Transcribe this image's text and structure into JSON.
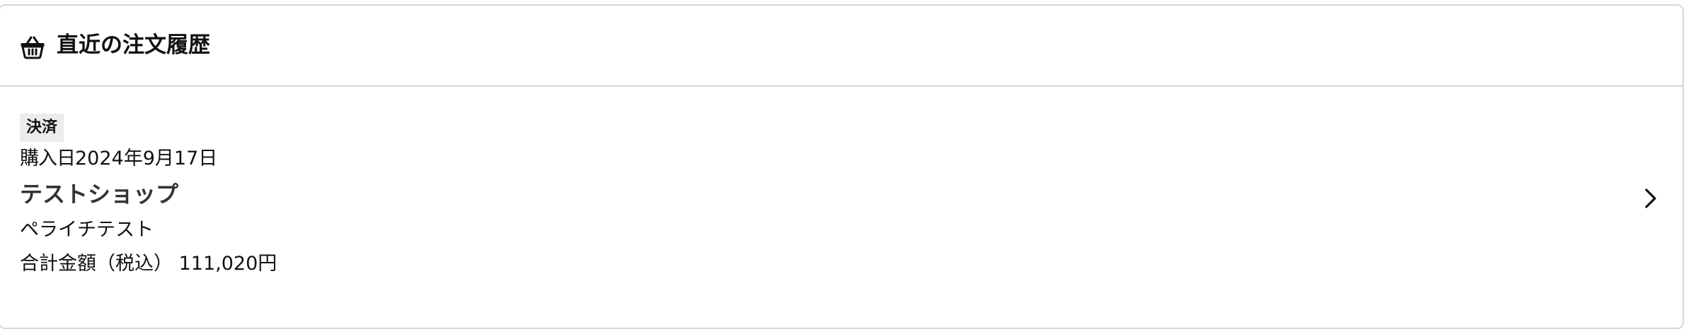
{
  "header": {
    "icon": "basket-icon",
    "title": "直近の注文履歴"
  },
  "order": {
    "status": "決済",
    "purchase_date_label": "購入日",
    "purchase_date": "2024年9月17日",
    "shop_name": "テストショップ",
    "product_name": "ペライチテスト",
    "total_label": "合計金額（税込）",
    "total_value": "111,020円",
    "chevron_icon": "chevron-right-icon"
  },
  "colors": {
    "border": "#d6d6d6",
    "badge_background": "#ececec",
    "text": "#111111",
    "shop_name_text": "#333333"
  }
}
